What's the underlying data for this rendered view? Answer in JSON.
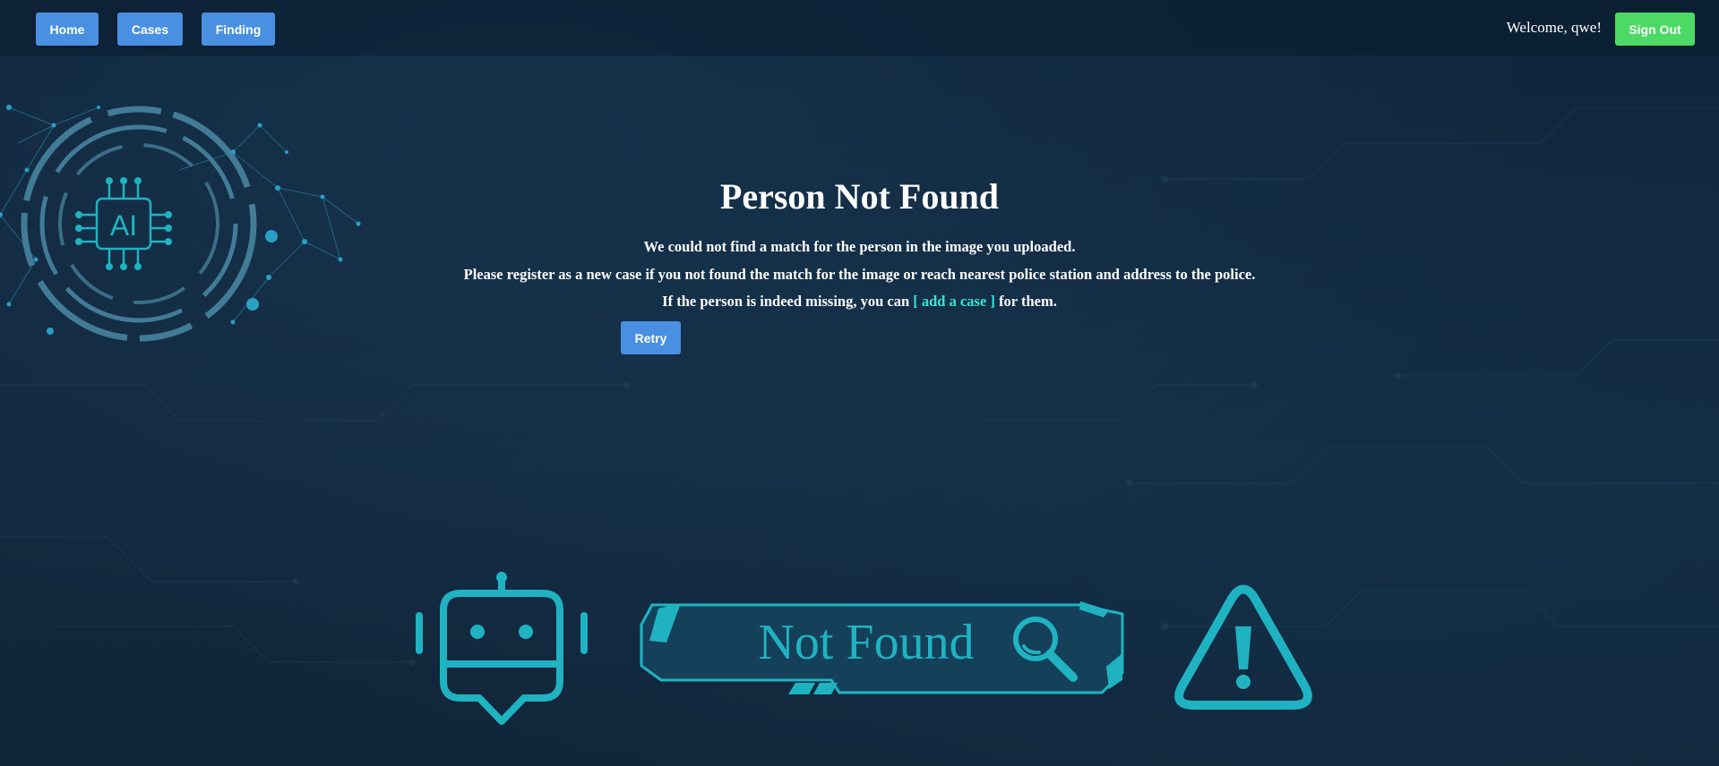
{
  "nav": {
    "home_label": "Home",
    "cases_label": "Cases",
    "finding_label": "Finding",
    "welcome_text": "Welcome, qwe!",
    "signout_label": "Sign Out"
  },
  "emblem": {
    "text": "AI"
  },
  "main": {
    "title": "Person Not Found",
    "line1": "We could not find a match for the person in the image you uploaded.",
    "line2": "Please register as a new case if you not found the match for the image or reach nearest police station and address to the police.",
    "line3_prefix": "If the person is indeed missing, you can ",
    "line3_link": "[ add a case ]",
    "line3_suffix": " for them.",
    "retry_label": "Retry"
  },
  "banner": {
    "text": "Not Found"
  },
  "colors": {
    "background": "#12283f",
    "primary_button": "#4a90e2",
    "signout_button": "#4cd964",
    "accent_cyan": "#1fb3c2",
    "link": "#33e6d8"
  },
  "icons": [
    "ai-chip-icon",
    "robot-chat-icon",
    "magnifier-icon",
    "warning-triangle-icon"
  ]
}
